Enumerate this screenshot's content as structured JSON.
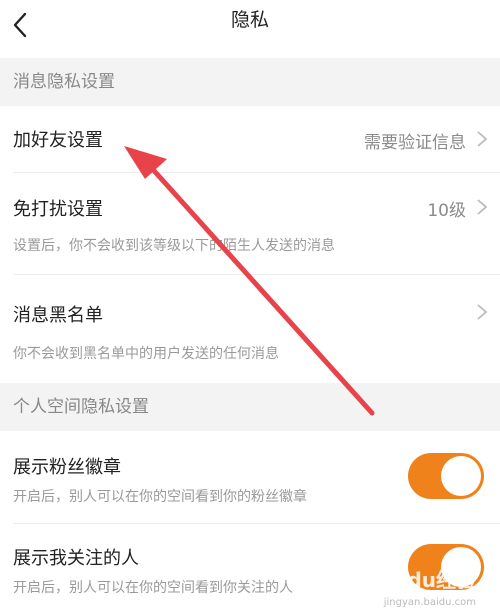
{
  "nav": {
    "title": "隐私"
  },
  "sections": {
    "message_privacy": "消息隐私设置",
    "space_privacy": "个人空间隐私设置"
  },
  "rows": {
    "add_friend": {
      "label": "加好友设置",
      "value": "需要验证信息"
    },
    "dnd": {
      "label": "免打扰设置",
      "value": "10级",
      "desc": "设置后，你不会收到该等级以下的陌生人发送的消息"
    },
    "blacklist": {
      "label": "消息黑名单",
      "desc": "你不会收到黑名单中的用户发送的任何消息"
    },
    "fan_badge": {
      "label": "展示粉丝徽章",
      "desc": "开启后，别人可以在你的空间看到你的粉丝徽章",
      "enabled": true
    },
    "following": {
      "label": "展示我关注的人",
      "desc": "开启后，别人可以在你的空间看到你关注的人",
      "enabled": true
    }
  },
  "watermark": {
    "brand": "Baidu经验",
    "url": "jingyan.baidu.com"
  },
  "colors": {
    "accent": "#f0821b",
    "arrow": "#e8434a",
    "section_bg": "#f3f3f3"
  },
  "icons": {
    "back": "chevron-left-icon",
    "chevron": "chevron-right-icon"
  }
}
